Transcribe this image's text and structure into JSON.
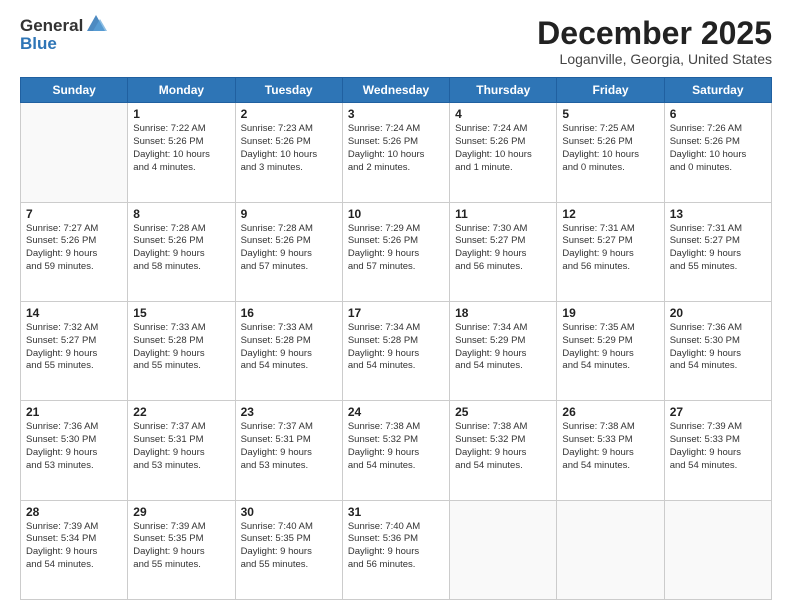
{
  "logo": {
    "general": "General",
    "blue": "Blue"
  },
  "header": {
    "month_title": "December 2025",
    "location": "Loganville, Georgia, United States"
  },
  "days_of_week": [
    "Sunday",
    "Monday",
    "Tuesday",
    "Wednesday",
    "Thursday",
    "Friday",
    "Saturday"
  ],
  "weeks": [
    [
      {
        "day": "",
        "info": ""
      },
      {
        "day": "1",
        "info": "Sunrise: 7:22 AM\nSunset: 5:26 PM\nDaylight: 10 hours\nand 4 minutes."
      },
      {
        "day": "2",
        "info": "Sunrise: 7:23 AM\nSunset: 5:26 PM\nDaylight: 10 hours\nand 3 minutes."
      },
      {
        "day": "3",
        "info": "Sunrise: 7:24 AM\nSunset: 5:26 PM\nDaylight: 10 hours\nand 2 minutes."
      },
      {
        "day": "4",
        "info": "Sunrise: 7:24 AM\nSunset: 5:26 PM\nDaylight: 10 hours\nand 1 minute."
      },
      {
        "day": "5",
        "info": "Sunrise: 7:25 AM\nSunset: 5:26 PM\nDaylight: 10 hours\nand 0 minutes."
      },
      {
        "day": "6",
        "info": "Sunrise: 7:26 AM\nSunset: 5:26 PM\nDaylight: 10 hours\nand 0 minutes."
      }
    ],
    [
      {
        "day": "7",
        "info": "Sunrise: 7:27 AM\nSunset: 5:26 PM\nDaylight: 9 hours\nand 59 minutes."
      },
      {
        "day": "8",
        "info": "Sunrise: 7:28 AM\nSunset: 5:26 PM\nDaylight: 9 hours\nand 58 minutes."
      },
      {
        "day": "9",
        "info": "Sunrise: 7:28 AM\nSunset: 5:26 PM\nDaylight: 9 hours\nand 57 minutes."
      },
      {
        "day": "10",
        "info": "Sunrise: 7:29 AM\nSunset: 5:26 PM\nDaylight: 9 hours\nand 57 minutes."
      },
      {
        "day": "11",
        "info": "Sunrise: 7:30 AM\nSunset: 5:27 PM\nDaylight: 9 hours\nand 56 minutes."
      },
      {
        "day": "12",
        "info": "Sunrise: 7:31 AM\nSunset: 5:27 PM\nDaylight: 9 hours\nand 56 minutes."
      },
      {
        "day": "13",
        "info": "Sunrise: 7:31 AM\nSunset: 5:27 PM\nDaylight: 9 hours\nand 55 minutes."
      }
    ],
    [
      {
        "day": "14",
        "info": "Sunrise: 7:32 AM\nSunset: 5:27 PM\nDaylight: 9 hours\nand 55 minutes."
      },
      {
        "day": "15",
        "info": "Sunrise: 7:33 AM\nSunset: 5:28 PM\nDaylight: 9 hours\nand 55 minutes."
      },
      {
        "day": "16",
        "info": "Sunrise: 7:33 AM\nSunset: 5:28 PM\nDaylight: 9 hours\nand 54 minutes."
      },
      {
        "day": "17",
        "info": "Sunrise: 7:34 AM\nSunset: 5:28 PM\nDaylight: 9 hours\nand 54 minutes."
      },
      {
        "day": "18",
        "info": "Sunrise: 7:34 AM\nSunset: 5:29 PM\nDaylight: 9 hours\nand 54 minutes."
      },
      {
        "day": "19",
        "info": "Sunrise: 7:35 AM\nSunset: 5:29 PM\nDaylight: 9 hours\nand 54 minutes."
      },
      {
        "day": "20",
        "info": "Sunrise: 7:36 AM\nSunset: 5:30 PM\nDaylight: 9 hours\nand 54 minutes."
      }
    ],
    [
      {
        "day": "21",
        "info": "Sunrise: 7:36 AM\nSunset: 5:30 PM\nDaylight: 9 hours\nand 53 minutes."
      },
      {
        "day": "22",
        "info": "Sunrise: 7:37 AM\nSunset: 5:31 PM\nDaylight: 9 hours\nand 53 minutes."
      },
      {
        "day": "23",
        "info": "Sunrise: 7:37 AM\nSunset: 5:31 PM\nDaylight: 9 hours\nand 53 minutes."
      },
      {
        "day": "24",
        "info": "Sunrise: 7:38 AM\nSunset: 5:32 PM\nDaylight: 9 hours\nand 54 minutes."
      },
      {
        "day": "25",
        "info": "Sunrise: 7:38 AM\nSunset: 5:32 PM\nDaylight: 9 hours\nand 54 minutes."
      },
      {
        "day": "26",
        "info": "Sunrise: 7:38 AM\nSunset: 5:33 PM\nDaylight: 9 hours\nand 54 minutes."
      },
      {
        "day": "27",
        "info": "Sunrise: 7:39 AM\nSunset: 5:33 PM\nDaylight: 9 hours\nand 54 minutes."
      }
    ],
    [
      {
        "day": "28",
        "info": "Sunrise: 7:39 AM\nSunset: 5:34 PM\nDaylight: 9 hours\nand 54 minutes."
      },
      {
        "day": "29",
        "info": "Sunrise: 7:39 AM\nSunset: 5:35 PM\nDaylight: 9 hours\nand 55 minutes."
      },
      {
        "day": "30",
        "info": "Sunrise: 7:40 AM\nSunset: 5:35 PM\nDaylight: 9 hours\nand 55 minutes."
      },
      {
        "day": "31",
        "info": "Sunrise: 7:40 AM\nSunset: 5:36 PM\nDaylight: 9 hours\nand 56 minutes."
      },
      {
        "day": "",
        "info": ""
      },
      {
        "day": "",
        "info": ""
      },
      {
        "day": "",
        "info": ""
      }
    ]
  ]
}
